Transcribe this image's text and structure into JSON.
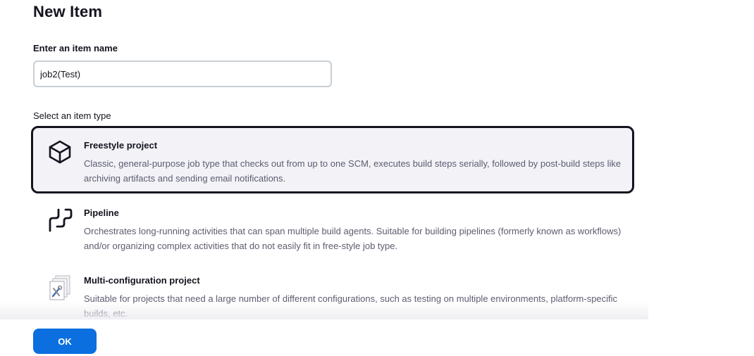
{
  "page": {
    "title": "New Item"
  },
  "name_field": {
    "label": "Enter an item name",
    "value": "job2(Test)"
  },
  "item_type": {
    "label": "Select an item type",
    "items": [
      {
        "title": "Freestyle project",
        "description": "Classic, general-purpose job type that checks out from up to one SCM, executes build steps serially, followed by post-build steps like archiving artifacts and sending email notifications.",
        "icon": "cube-icon",
        "selected": true
      },
      {
        "title": "Pipeline",
        "description": "Orchestrates long-running activities that can span multiple build agents. Suitable for building pipelines (formerly known as workflows) and/or organizing complex activities that do not easily fit in free-style job type.",
        "icon": "pipeline-icon",
        "selected": false
      },
      {
        "title": "Multi-configuration project",
        "description": "Suitable for projects that need a large number of different configurations, such as testing on multiple environments, platform-specific builds, etc.",
        "icon": "multi-config-icon",
        "selected": false
      }
    ]
  },
  "footer": {
    "ok_label": "OK"
  },
  "colors": {
    "accent": "#0b6fe0",
    "selected_bg": "#f2f2f7",
    "selected_border": "#14141f",
    "description_text": "#5c5c70"
  }
}
